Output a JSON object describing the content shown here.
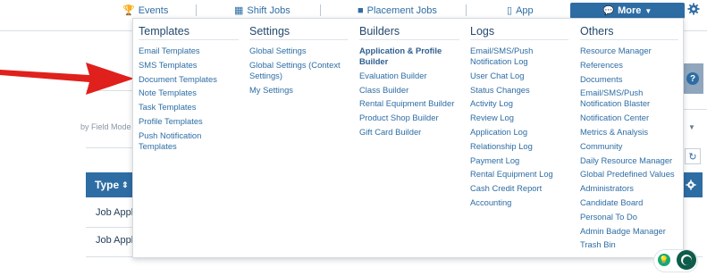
{
  "topnav": {
    "events_label": "Events",
    "shift_jobs_label": "Shift Jobs",
    "placement_jobs_label": "Placement Jobs",
    "app_label": "App",
    "more_label": "More"
  },
  "background": {
    "field_label": "by Field Mode",
    "type_header": "Type",
    "rows": [
      "Job Appl",
      "Job Appl"
    ]
  },
  "menu": {
    "templates": {
      "title": "Templates",
      "items": [
        "Email Templates",
        "SMS Templates",
        "Document Templates",
        "Note Templates",
        "Task Templates",
        "Profile Templates",
        "Push Notification Templates"
      ]
    },
    "settings": {
      "title": "Settings",
      "items": [
        "Global Settings",
        "Global Settings (Context Settings)",
        "My Settings"
      ]
    },
    "builders": {
      "title": "Builders",
      "items": [
        "Application & Profile Builder",
        "Evaluation Builder",
        "Class Builder",
        "Rental Equipment Builder",
        "Product Shop Builder",
        "Gift Card Builder"
      ]
    },
    "logs": {
      "title": "Logs",
      "items": [
        "Email/SMS/Push Notification Log",
        "User Chat Log",
        "Status Changes",
        "Activity Log",
        "Review Log",
        "Application Log",
        "Relationship Log",
        "Payment Log",
        "Rental Equipment Log",
        "Cash Credit Report",
        "Accounting"
      ]
    },
    "others": {
      "title": "Others",
      "items": [
        "Resource Manager",
        "References",
        "Documents",
        "Email/SMS/Push Notification Blaster",
        "Notification Center",
        "Metrics & Analysis",
        "Community",
        "Daily Resource Manager",
        "Global Predefined Values",
        "Administrators",
        "Candidate Board",
        "Personal To Do",
        "Admin Badge Manager",
        "Trash Bin"
      ]
    }
  },
  "colors": {
    "accent": "#2e6da4",
    "arrow": "#e0201c"
  },
  "icons": {
    "events": "trophy-icon",
    "shift_jobs": "calendar-icon",
    "placement_jobs": "briefcase-icon",
    "app": "phone-icon",
    "more": "chat-icon",
    "settings": "gear-icon"
  }
}
